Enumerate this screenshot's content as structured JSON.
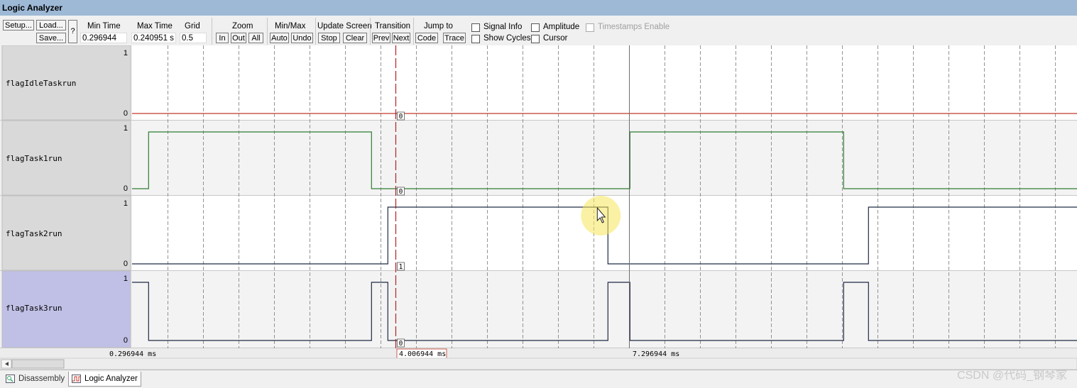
{
  "window": {
    "title": "Logic Analyzer"
  },
  "toolbar": {
    "setup": "Setup...",
    "load": "Load...",
    "save": "Save...",
    "help": "?",
    "min_time_label": "Min Time",
    "min_time_value": "0.296944 ms",
    "max_time_label": "Max Time",
    "max_time_value": "0.240951 s",
    "grid_label": "Grid",
    "grid_value": "0.5 ms",
    "zoom_label": "Zoom",
    "zoom_in": "In",
    "zoom_out": "Out",
    "zoom_all": "All",
    "minmax_label": "Min/Max",
    "auto": "Auto",
    "undo": "Undo",
    "update_label": "Update Screen",
    "stop": "Stop",
    "clear": "Clear",
    "transition_label": "Transition",
    "prev": "Prev",
    "next": "Next",
    "jump_label": "Jump to",
    "code": "Code",
    "trace": "Trace",
    "signal_info": "Signal Info",
    "show_cycles": "Show Cycles",
    "amplitude": "Amplitude",
    "cursor": "Cursor",
    "timestamps": "Timestamps Enable"
  },
  "tabs": [
    {
      "label": "Disassembly"
    },
    {
      "label": "Logic Analyzer"
    }
  ],
  "watermark": "CSDN @代码_钢琴家",
  "colors": {
    "title_bar": "#9db9d6",
    "idle": "#c0392b",
    "task1": "#2e7d32",
    "task2": "#1f2a44",
    "task3": "#1f2a44",
    "selected_row": "#c0c0e6",
    "cursor": "#b22222",
    "highlight": "#f5e55a"
  },
  "chart_data": {
    "type": "digital-waveform",
    "time_range_ms": [
      0.296944,
      13.8
    ],
    "grid_ms": 0.5,
    "signals": [
      {
        "name": "flagIdleTaskrun",
        "ymax": "1",
        "ymin": "0",
        "transitions": [
          [
            0.296944,
            0
          ]
        ]
      },
      {
        "name": "flagTask1run",
        "ymax": "1",
        "ymin": "0",
        "transitions": [
          [
            0.296944,
            0
          ],
          [
            0.53,
            1
          ],
          [
            3.67,
            0
          ],
          [
            7.31,
            1
          ],
          [
            10.32,
            0
          ]
        ]
      },
      {
        "name": "flagTask2run",
        "ymax": "1",
        "ymin": "0",
        "transitions": [
          [
            0.296944,
            0
          ],
          [
            3.9,
            1
          ],
          [
            7.0,
            0
          ],
          [
            10.67,
            1
          ]
        ]
      },
      {
        "name": "flagTask3run",
        "ymax": "1",
        "ymin": "0",
        "transitions": [
          [
            0.296944,
            1
          ],
          [
            0.53,
            0
          ],
          [
            3.67,
            1
          ],
          [
            3.9,
            0
          ],
          [
            7.0,
            1
          ],
          [
            7.31,
            0
          ],
          [
            10.32,
            1
          ],
          [
            10.67,
            0
          ]
        ]
      }
    ],
    "axis_labels": [
      {
        "t": 0.296944,
        "text": "0.296944 ms"
      },
      {
        "t": 4.006944,
        "text": "4.006944 ms"
      },
      {
        "t": 7.296944,
        "text": "7.296944 ms"
      }
    ],
    "cursor_t": 4.006944,
    "cursor_values": [
      "0",
      "0",
      "1",
      "0"
    ],
    "marker_t": 7.296944,
    "highlight_t": 6.9
  }
}
